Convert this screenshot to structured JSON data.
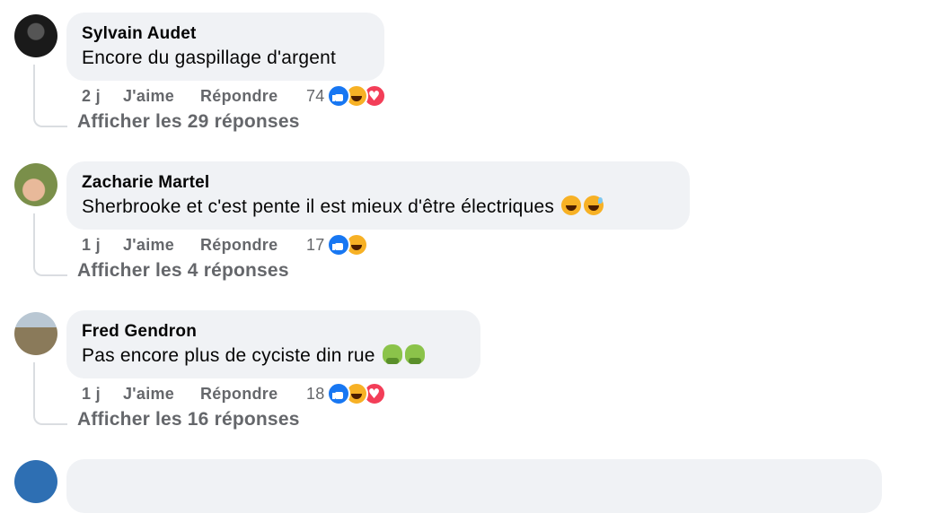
{
  "comments": [
    {
      "author": "Sylvain Audet",
      "text": "Encore du gaspillage d'argent",
      "emoji": [],
      "time": "2 j",
      "like_label": "J'aime",
      "reply_label": "Répondre",
      "reaction_count": "74",
      "reactions": [
        "like",
        "haha",
        "love"
      ],
      "view_replies": "Afficher les 29 réponses"
    },
    {
      "author": "Zacharie Martel",
      "text": "Sherbrooke et c'est pente il est mieux d'être électriques",
      "emoji": [
        "laughing-tears",
        "grinning-sweat"
      ],
      "time": "1 j",
      "like_label": "J'aime",
      "reply_label": "Répondre",
      "reaction_count": "17",
      "reactions": [
        "like",
        "haha"
      ],
      "view_replies": "Afficher les 4 réponses"
    },
    {
      "author": "Fred Gendron",
      "text": "Pas encore plus de cyciste din rue",
      "emoji": [
        "nauseated-face",
        "nauseated-face"
      ],
      "time": "1 j",
      "like_label": "J'aime",
      "reply_label": "Répondre",
      "reaction_count": "18",
      "reactions": [
        "like",
        "haha",
        "love"
      ],
      "view_replies": "Afficher les 16 réponses"
    }
  ],
  "colors": {
    "bubble_bg": "#f0f2f5",
    "meta_text": "#65676b",
    "like_blue": "#1877f2",
    "haha_yellow": "#f7b125",
    "love_red": "#f33e58"
  }
}
